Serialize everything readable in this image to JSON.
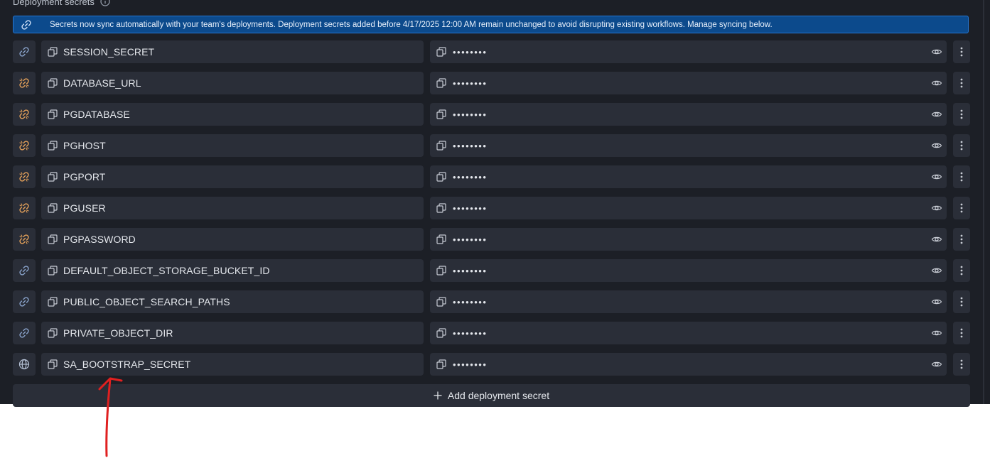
{
  "section": {
    "title": "Deployment secrets"
  },
  "banner": {
    "text": "Secrets now sync automatically with your team's deployments. Deployment secrets added before 4/17/2025 12:00 AM remain unchanged to avoid disrupting existing workflows. Manage syncing below."
  },
  "colors": {
    "synced": "#8aa4cc",
    "unsynced": "#e6a25a",
    "global": "#b6c2d6",
    "annotation": "#e02020"
  },
  "secrets": [
    {
      "key": "SESSION_SECRET",
      "value": "••••••••",
      "sync_icon": "link-icon"
    },
    {
      "key": "DATABASE_URL",
      "value": "••••••••",
      "sync_icon": "broken-link-icon"
    },
    {
      "key": "PGDATABASE",
      "value": "••••••••",
      "sync_icon": "broken-link-icon"
    },
    {
      "key": "PGHOST",
      "value": "••••••••",
      "sync_icon": "broken-link-icon"
    },
    {
      "key": "PGPORT",
      "value": "••••••••",
      "sync_icon": "broken-link-icon"
    },
    {
      "key": "PGUSER",
      "value": "••••••••",
      "sync_icon": "broken-link-icon"
    },
    {
      "key": "PGPASSWORD",
      "value": "••••••••",
      "sync_icon": "broken-link-icon"
    },
    {
      "key": "DEFAULT_OBJECT_STORAGE_BUCKET_ID",
      "value": "••••••••",
      "sync_icon": "link-icon"
    },
    {
      "key": "PUBLIC_OBJECT_SEARCH_PATHS",
      "value": "••••••••",
      "sync_icon": "link-icon"
    },
    {
      "key": "PRIVATE_OBJECT_DIR",
      "value": "••••••••",
      "sync_icon": "link-icon"
    },
    {
      "key": "SA_BOOTSTRAP_SECRET",
      "value": "••••••••",
      "sync_icon": "globe-icon"
    }
  ],
  "add_button": {
    "label": "Add deployment secret"
  }
}
